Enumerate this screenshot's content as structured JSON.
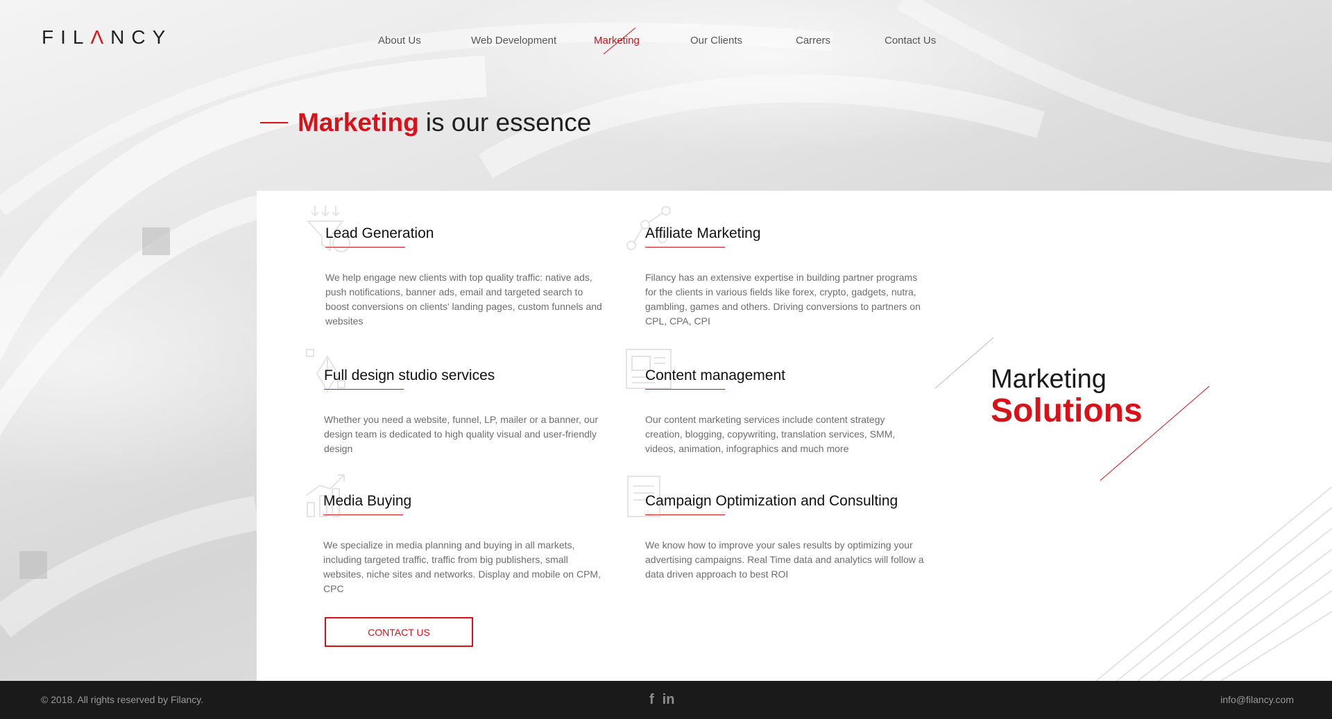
{
  "brand": {
    "logo_pre": "FIL",
    "logo_a": "Λ",
    "logo_post": "NCY"
  },
  "nav": [
    {
      "label": "About Us"
    },
    {
      "label": "Web Development"
    },
    {
      "label": "Marketing",
      "active": true
    },
    {
      "label": "Our Clients"
    },
    {
      "label": "Carrers"
    },
    {
      "label": "Contact Us"
    }
  ],
  "hero": {
    "highlight": "Marketing",
    "rest": "is our essence"
  },
  "services": [
    {
      "title": "Lead Generation",
      "icon": "funnel-dollar-icon",
      "text": "We help engage new clients with top quality traffic: native ads, push notifications, banner ads, email and targeted search to boost conversions on clients' landing pages, custom funnels and websites"
    },
    {
      "title": "Affiliate Marketing",
      "icon": "network-nodes-icon",
      "text": "Filancy has an extensive expertise in building partner programs for the clients in various fields like forex, crypto, gadgets, nutra, gambling, games and others. Driving conversions to partners on CPL, CPA, CPI"
    },
    {
      "title": "Full design studio services",
      "icon": "pen-tool-icon",
      "text": "Whether you need a website, funnel, LP, mailer or a banner, our design team is dedicated to high quality visual and user-friendly design"
    },
    {
      "title": "Content management",
      "icon": "content-layout-icon",
      "text": "Our content marketing services include content strategy creation, blogging, copywriting, translation services, SMM, videos, animation, infographics and much more"
    },
    {
      "title": "Media Buying",
      "icon": "growth-chart-icon",
      "text": "We specialize in media planning and buying in all markets, including targeted traffic, traffic from big publishers, small websites, niche sites and networks. Display and mobile on CPM, CPC"
    },
    {
      "title": "Campaign Optimization and Consulting",
      "icon": "document-chart-icon",
      "text": "We know how to improve your sales results by optimizing your advertising campaigns. Real Time data and analytics will follow a data driven approach to best ROI"
    }
  ],
  "cta": {
    "label": "CONTACT US"
  },
  "side": {
    "line1": "Marketing",
    "line2": "Solutions"
  },
  "footer": {
    "copyright": "© 2018. All rights reserved by Filancy.",
    "social": [
      {
        "label": "f",
        "icon": "facebook-icon"
      },
      {
        "label": "in",
        "icon": "linkedin-icon"
      }
    ],
    "email": "info@filancy.com"
  },
  "colors": {
    "accent": "#d9121a",
    "footer_bg": "#1a1a1a",
    "text_grey": "#6d6d6d"
  }
}
